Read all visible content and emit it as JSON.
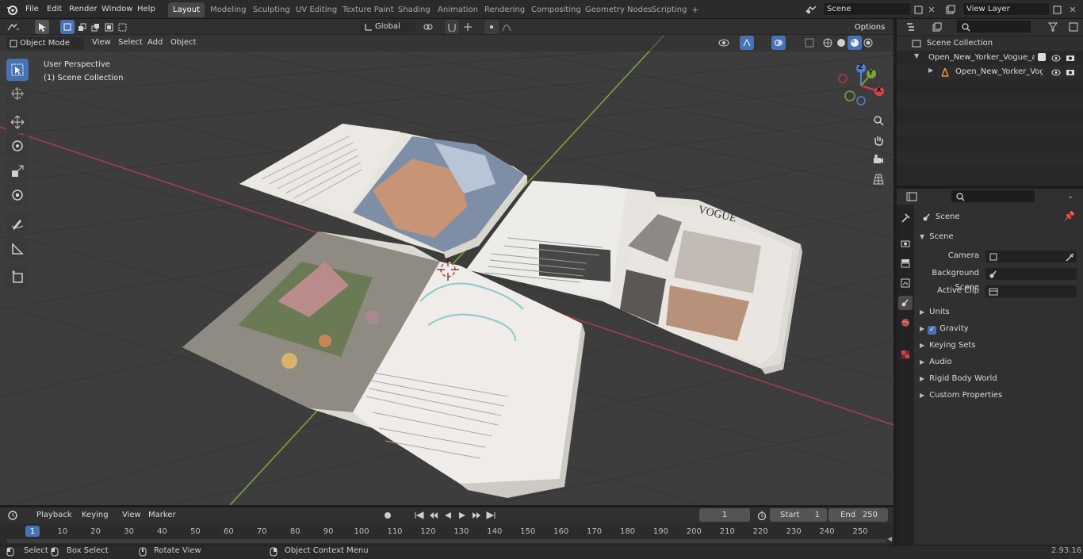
{
  "app": {
    "menus": [
      "File",
      "Edit",
      "Render",
      "Window",
      "Help"
    ],
    "workspace_tabs": [
      "Layout",
      "Modeling",
      "Sculpting",
      "UV Editing",
      "Texture Paint",
      "Shading",
      "Animation",
      "Rendering",
      "Compositing",
      "Geometry Nodes",
      "Scripting"
    ],
    "active_tab": "Layout",
    "scene_name": "Scene",
    "view_layer": "View Layer"
  },
  "viewport": {
    "mode": "Object Mode",
    "menus": [
      "View",
      "Select",
      "Add",
      "Object"
    ],
    "orientation": "Global",
    "options_label": "Options",
    "overlay_line1": "User Perspective",
    "overlay_line2": "(1) Scene Collection",
    "gizmo_axes": [
      "Z",
      "Y",
      "X"
    ],
    "colors": {
      "grid_bg": "#3d3d3d",
      "x_axis": "#b03a48",
      "y_axis": "#7aa33a",
      "accent": "#4772b3"
    },
    "tools": [
      "select-box-icon",
      "cursor-icon",
      "move-icon",
      "rotate-icon",
      "scale-icon",
      "transform-icon",
      "annotate-icon",
      "measure-icon",
      "add-cube-icon"
    ]
  },
  "outliner": {
    "root": "Scene Collection",
    "items": [
      {
        "label": "Open_New_Yorker_Vogue_ar",
        "level": 1
      },
      {
        "label": "Open_New_Yorker_Vogu",
        "level": 2
      }
    ]
  },
  "properties": {
    "context": "Scene",
    "section": "Scene",
    "fields": [
      {
        "label": "Camera",
        "value": ""
      },
      {
        "label": "Background Scene",
        "value": ""
      },
      {
        "label": "Active Clip",
        "value": ""
      }
    ],
    "panels": [
      "Units",
      "Gravity",
      "Keying Sets",
      "Audio",
      "Rigid Body World",
      "Custom Properties"
    ],
    "gravity_checked": true
  },
  "timeline": {
    "menus": [
      "Playback",
      "Keying",
      "View",
      "Marker"
    ],
    "current_frame": "1",
    "start_label": "Start",
    "start_value": "1",
    "end_label": "End",
    "end_value": "250",
    "ruler": [
      "1",
      "10",
      "20",
      "30",
      "40",
      "50",
      "60",
      "70",
      "80",
      "90",
      "100",
      "110",
      "120",
      "130",
      "140",
      "150",
      "160",
      "170",
      "180",
      "190",
      "200",
      "210",
      "220",
      "230",
      "240",
      "250"
    ]
  },
  "status": {
    "select": "Select",
    "box_select": "Box Select",
    "rotate_view": "Rotate View",
    "context_menu": "Object Context Menu",
    "version": "2.93.16"
  }
}
